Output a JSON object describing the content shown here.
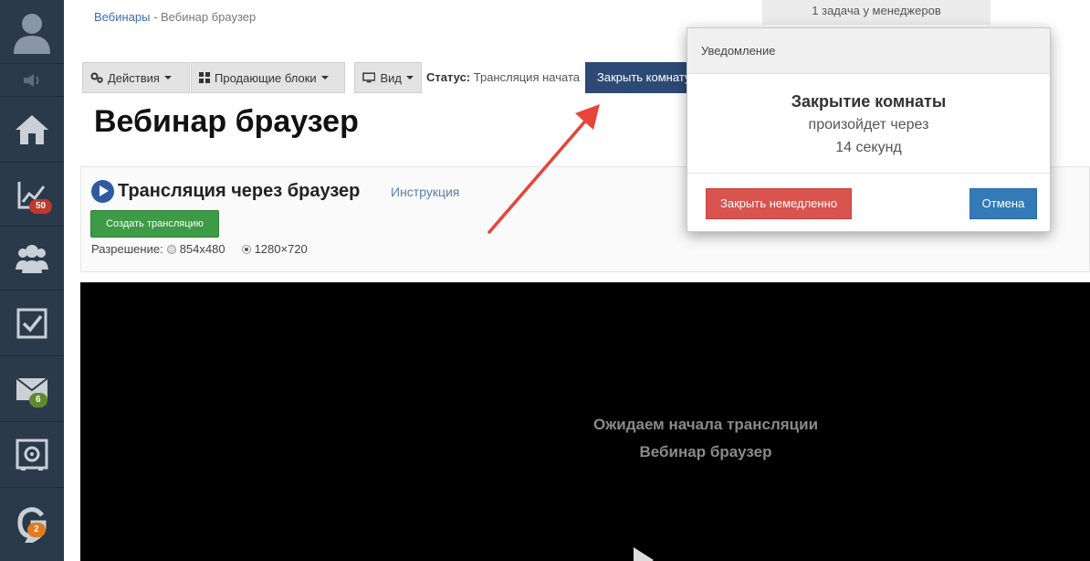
{
  "sidebar": {
    "badges": {
      "stats": "50",
      "messages": "6",
      "chat": "2"
    },
    "colors": {
      "bg": "#2a3a4a",
      "badge_red": "#c0392b",
      "badge_green": "#5e8a2c",
      "badge_orange": "#e07b1f"
    },
    "icons": [
      "avatar-icon",
      "speaker-icon",
      "home-icon",
      "chart-icon",
      "users-icon",
      "checkbox-icon",
      "mail-icon",
      "safe-icon",
      "chat-icon"
    ]
  },
  "breadcrumb": {
    "link": "Вебинары",
    "separator": " - ",
    "current": "Вебинар браузер"
  },
  "tasks_label": "1 задача у менеджеров",
  "toolbar": {
    "actions_label": "Действия",
    "blocks_label": "Продающие блоки",
    "view_label": "Вид",
    "status_label": "Статус:",
    "status_value": "Трансляция начата",
    "close_room_label": "Закрыть комнату"
  },
  "page_title": "Вебинар браузер",
  "broadcast": {
    "title": "Трансляция через браузер",
    "instruction_link": "Инструкция",
    "create_button": "Создать трансляцию",
    "resolution_label": "Разрешение:",
    "options": [
      "854x480",
      "1280×720"
    ],
    "selected": "1280×720"
  },
  "player": {
    "waiting_line1": "Ожидаем начала трансляции",
    "waiting_line2": "Вебинар браузер"
  },
  "modal": {
    "header": "Уведомление",
    "title": "Закрытие комнаты",
    "line2": "произойдет через",
    "line3": "14 секунд",
    "close_now_button": "Закрыть немедленно",
    "cancel_button": "Отмена"
  },
  "annotation": {
    "arrow_color": "#e8443a"
  }
}
